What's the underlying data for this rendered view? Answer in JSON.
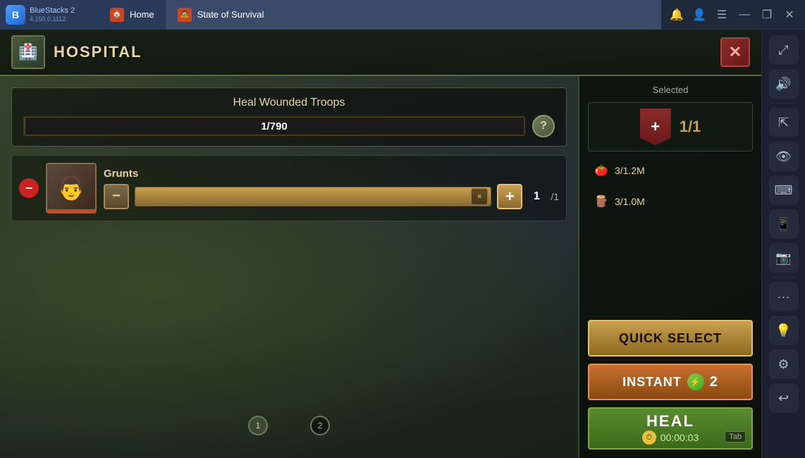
{
  "app": {
    "name": "BlueStacks 2",
    "version": "4.150.0.1112",
    "home_tab": "Home",
    "game_tab": "State of Survival"
  },
  "hospital": {
    "title": "HOSPITAL",
    "close_label": "✕",
    "heal_title": "Heal Wounded Troops",
    "heal_count": "1/790",
    "help_label": "?",
    "selected_label": "Selected",
    "selected_count": "1/1",
    "troop_name": "Grunts",
    "troop_current": "1",
    "troop_max": "/1",
    "resource1": "3/1.2M",
    "resource2": "3/1.0M",
    "quick_select_label": "QUICK SELECT",
    "instant_label": "INSTANT",
    "instant_count": "2",
    "heal_label": "HEAL",
    "heal_time": "00:00:03",
    "tab_label": "Tab",
    "page1": "1",
    "page2": "2"
  }
}
